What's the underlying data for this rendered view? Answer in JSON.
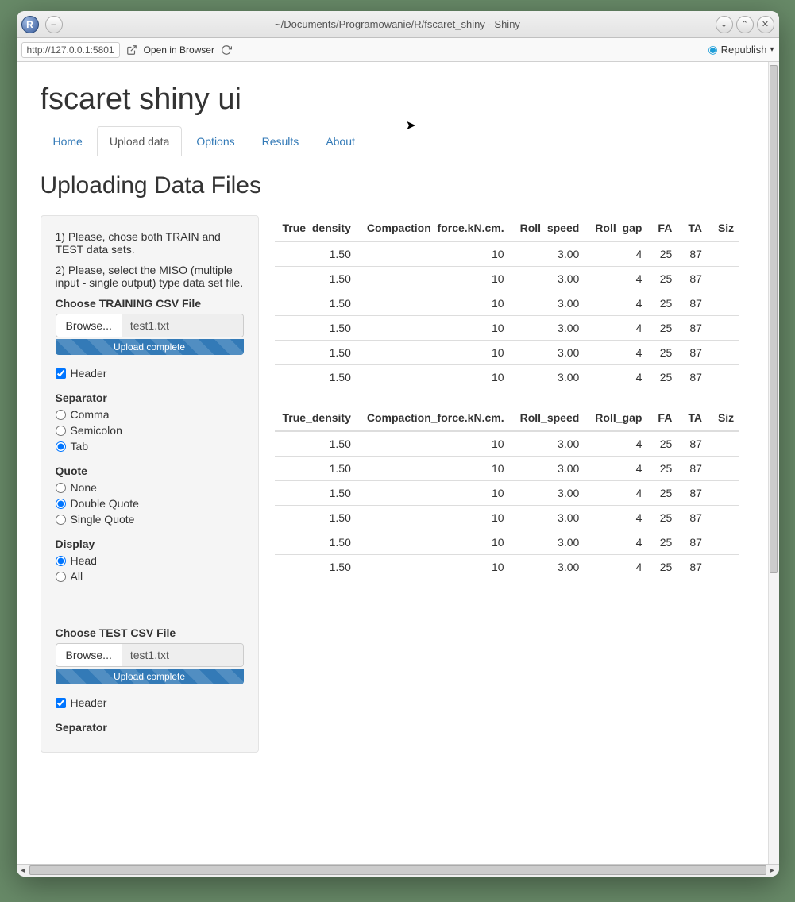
{
  "window": {
    "title": "~/Documents/Programowanie/R/fscaret_shiny - Shiny",
    "url": "http://127.0.0.1:5801",
    "open_in_browser": "Open in Browser",
    "republish": "Republish"
  },
  "app": {
    "title": "fscaret shiny ui",
    "tabs": [
      "Home",
      "Upload data",
      "Options",
      "Results",
      "About"
    ],
    "active_tab": 1,
    "section_heading": "Uploading Data Files"
  },
  "sidebar": {
    "instr1": "1) Please, chose both TRAIN and TEST data sets.",
    "instr2": "2) Please, select the MISO (multiple input - single output) type data set file.",
    "train": {
      "label": "Choose TRAINING CSV File",
      "browse": "Browse...",
      "filename": "test1.txt",
      "progress": "Upload complete"
    },
    "test": {
      "label": "Choose TEST CSV File",
      "browse": "Browse...",
      "filename": "test1.txt",
      "progress": "Upload complete"
    },
    "header_label": "Header",
    "separator_label": "Separator",
    "sep_options": [
      "Comma",
      "Semicolon",
      "Tab"
    ],
    "sep_selected": 2,
    "quote_label": "Quote",
    "quote_options": [
      "None",
      "Double Quote",
      "Single Quote"
    ],
    "quote_selected": 1,
    "display_label": "Display",
    "display_options": [
      "Head",
      "All"
    ],
    "display_selected": 0,
    "test_header_label": "Header",
    "test_separator_label": "Separator"
  },
  "tables": {
    "headers": [
      "True_density",
      "Compaction_force.kN.cm.",
      "Roll_speed",
      "Roll_gap",
      "FA",
      "TA",
      "Size"
    ],
    "rows1": [
      [
        "1.50",
        "10",
        "3.00",
        "4",
        "25",
        "87"
      ],
      [
        "1.50",
        "10",
        "3.00",
        "4",
        "25",
        "87"
      ],
      [
        "1.50",
        "10",
        "3.00",
        "4",
        "25",
        "87"
      ],
      [
        "1.50",
        "10",
        "3.00",
        "4",
        "25",
        "87"
      ],
      [
        "1.50",
        "10",
        "3.00",
        "4",
        "25",
        "87"
      ],
      [
        "1.50",
        "10",
        "3.00",
        "4",
        "25",
        "87"
      ]
    ],
    "rows2": [
      [
        "1.50",
        "10",
        "3.00",
        "4",
        "25",
        "87"
      ],
      [
        "1.50",
        "10",
        "3.00",
        "4",
        "25",
        "87"
      ],
      [
        "1.50",
        "10",
        "3.00",
        "4",
        "25",
        "87"
      ],
      [
        "1.50",
        "10",
        "3.00",
        "4",
        "25",
        "87"
      ],
      [
        "1.50",
        "10",
        "3.00",
        "4",
        "25",
        "87"
      ],
      [
        "1.50",
        "10",
        "3.00",
        "4",
        "25",
        "87"
      ]
    ]
  }
}
